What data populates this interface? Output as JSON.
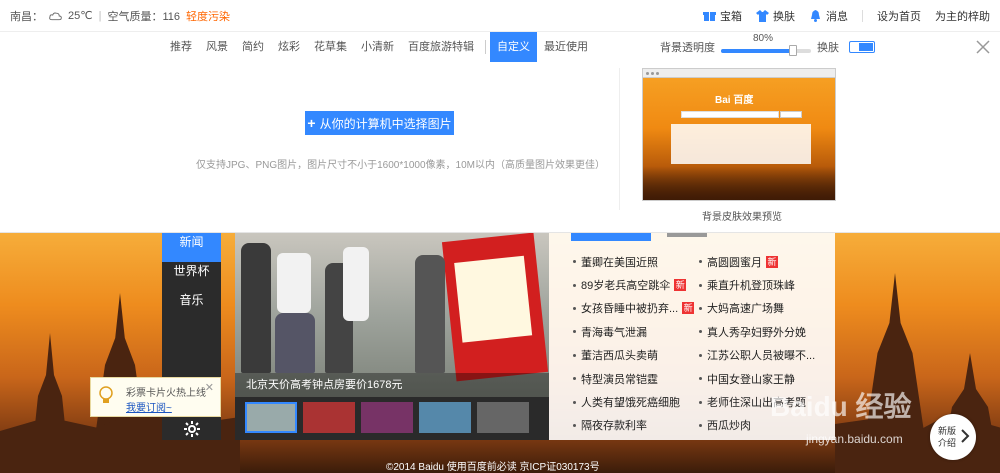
{
  "topbar": {
    "city": "南昌：",
    "temp": "25℃",
    "sep": "|",
    "aqi": "空气质量：116",
    "pollution": "轻度污染",
    "links": [
      "宝箱",
      "换肤",
      "消息",
      "设为首页",
      "为主的梓助"
    ]
  },
  "skin": {
    "tabs": [
      "推荐",
      "风景",
      "简约",
      "炫彩",
      "花草集",
      "小清新",
      "百度旅游特辑",
      "自定义",
      "最近使用"
    ],
    "active_tab": "自定义",
    "opacity_label": "背景透明度",
    "opacity_value": "80%",
    "opacity_fraction": 0.8,
    "skin_toggle_label": "换肤",
    "upload_label": "从你的计算机中选择图片",
    "upload_hint": "仅支持JPG、PNG图片，图片尺寸不小于1600*1000像素，10M以内（高质量图片效果更佳）",
    "preview_label": "背景皮肤效果预览",
    "preview_logo": "Bai 百度"
  },
  "nav": {
    "items": [
      "新闻",
      "世界杯",
      "音乐"
    ]
  },
  "photo": {
    "caption": "北京天价高考钟点房要价1678元"
  },
  "news": {
    "left": [
      {
        "text": "董卿在美国近照",
        "new": false
      },
      {
        "text": "89岁老兵高空跳伞",
        "new": true
      },
      {
        "text": "女孩昏睡中被扔弃...",
        "new": true
      },
      {
        "text": "青海毒气泄漏",
        "new": false
      },
      {
        "text": "董洁西瓜头卖萌",
        "new": false
      },
      {
        "text": "特型演员常铠霆",
        "new": false
      },
      {
        "text": "人类有望饿死癌细胞",
        "new": false
      },
      {
        "text": "隔夜存款利率",
        "new": false
      }
    ],
    "right": [
      {
        "text": "高圆圆蜜月",
        "new": true
      },
      {
        "text": "乘直升机登顶珠峰",
        "new": false
      },
      {
        "text": "大妈高速广场舞",
        "new": false
      },
      {
        "text": "真人秀孕妇野外分娩",
        "new": false
      },
      {
        "text": "江苏公职人员被曝不...",
        "new": false
      },
      {
        "text": "中国女登山家王静",
        "new": false
      },
      {
        "text": "老师住深山出高考题",
        "new": false
      },
      {
        "text": "西瓜炒肉",
        "new": false
      }
    ],
    "new_badge": "新"
  },
  "lottery": {
    "line1": "彩票卡片火热上线",
    "link": "我要订阅~",
    "close": "✕"
  },
  "footer": "©2014  Baidu  使用百度前必读  京ICP证030173号",
  "intro": {
    "line1": "新版",
    "line2": "介绍"
  },
  "watermark": {
    "line1": "Baidu 经验",
    "line2": "jingyan.baidu.com"
  },
  "colors": {
    "accent": "#3388ff",
    "pollution": "#ff6600",
    "badge": "#ee3333"
  }
}
